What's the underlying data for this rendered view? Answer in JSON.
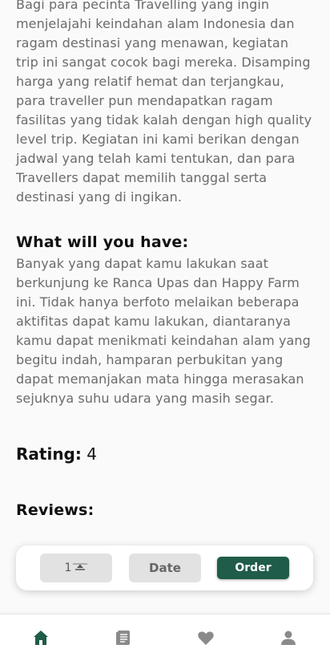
{
  "description_paragraph": "Bagi para pecinta Travelling yang ingin menjelajahi keindahan alam Indonesia dan ragam destinasi yang menawan, kegiatan trip ini sangat cocok bagi mereka. Disamping harga yang relatif hemat dan terjangkau, para traveller pun mendapatkan ragam fasilitas yang tidak kalah dengan high quality level trip. Kegiatan ini kami berikan dengan jadwal yang telah kami tentukan, dan para Travellers dapat memilih tanggal serta destinasi yang di ingikan.",
  "what_heading": "What will you have:",
  "what_paragraph": "Banyak yang dapat kamu lakukan saat berkunjung ke Ranca Upas dan Happy Farm ini. Tidak hanya berfoto melaikan beberapa aktifitas dapat kamu lakukan, diantaranya kamu dapat menikmati keindahan alam yang begitu indah, hamparan perbukitan yang dapat memanjakan mata hingga merasakan sejuknya suhu udara yang masih segar.",
  "rating": {
    "label": "Rating:",
    "value": "4"
  },
  "reviews_heading": "Reviews:",
  "order_bar": {
    "quantity": "1",
    "date_label": "Date",
    "order_label": "Order"
  },
  "nav": {
    "items": [
      "home-icon",
      "book-icon",
      "heart-icon",
      "user-icon"
    ],
    "active_color": "#1f5c49",
    "inactive_color": "#8a8a8a"
  },
  "colors": {
    "accent": "#1f5c49",
    "text_muted": "#6b6b6b"
  }
}
